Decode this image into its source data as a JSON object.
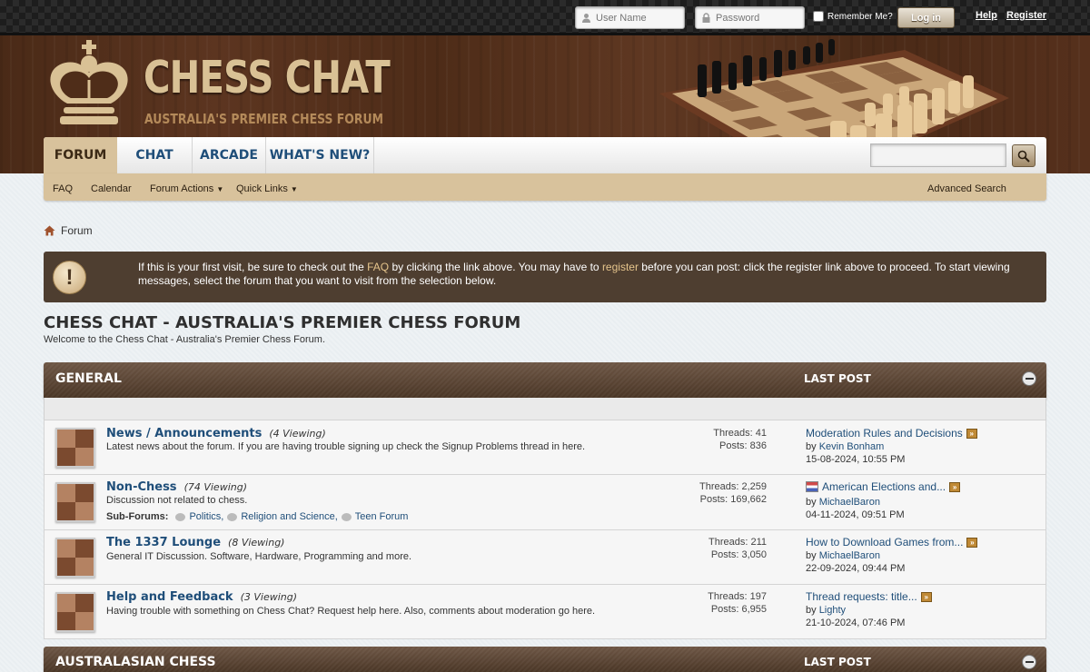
{
  "login": {
    "username_placeholder": "User Name",
    "password_placeholder": "Password",
    "remember_label": "Remember Me?",
    "login_button": "Log in",
    "help_link": "Help",
    "register_link": "Register"
  },
  "brand": {
    "title": "CHESS CHAT",
    "subtitle": "AUSTRALIA'S PREMIER CHESS FORUM"
  },
  "nav": {
    "tabs": [
      {
        "label": "FORUM",
        "active": true
      },
      {
        "label": "CHAT"
      },
      {
        "label": "ARCADE"
      },
      {
        "label": "WHAT'S NEW?"
      }
    ],
    "subnav": {
      "faq": "FAQ",
      "calendar": "Calendar",
      "forum_actions": "Forum Actions",
      "quick_links": "Quick Links",
      "advanced_search": "Advanced Search"
    }
  },
  "breadcrumb": {
    "label": "Forum"
  },
  "notice": {
    "icon": "!",
    "part1": "If this is your first visit, be sure to check out the ",
    "faq_link": "FAQ",
    "part2": " by clicking the link above. You may have to ",
    "register_link": "register",
    "part3": " before you can post: click the register link above to proceed. To start viewing messages, select the forum that you want to visit from the selection below."
  },
  "page": {
    "title": "CHESS CHAT - AUSTRALIA'S PREMIER CHESS FORUM",
    "welcome": "Welcome to the Chess Chat - Australia's Premier Chess Forum."
  },
  "categories": [
    {
      "title": "GENERAL",
      "last_post_header": "LAST POST"
    },
    {
      "title": "AUSTRALASIAN CHESS",
      "last_post_header": "LAST POST"
    }
  ],
  "forums": [
    {
      "name": "News / Announcements",
      "viewing": "(4 Viewing)",
      "description": "Latest news about the forum. If you are having trouble signing up check the Signup Problems thread in here.",
      "threads": "Threads: 41",
      "posts": "Posts: 836",
      "last_title": "Moderation Rules and Decisions",
      "last_by": "by",
      "last_user": "Kevin Bonham",
      "last_date": "15-08-2024,",
      "last_time": "10:55 PM"
    },
    {
      "name": "Non-Chess",
      "viewing": "(74 Viewing)",
      "description": "Discussion not related to chess.",
      "subforums_label": "Sub-Forums:",
      "subforums": [
        "Politics,",
        "Religion and Science,",
        "Teen Forum"
      ],
      "threads": "Threads: 2,259",
      "posts": "Posts: 169,662",
      "last_title": "American Elections and...",
      "last_by": "by",
      "last_user": "MichaelBaron",
      "last_date": "04-11-2024,",
      "last_time": "09:51 PM"
    },
    {
      "name": "The 1337 Lounge",
      "viewing": "(8 Viewing)",
      "description": "General IT Discussion. Software, Hardware, Programming and more.",
      "threads": "Threads: 211",
      "posts": "Posts: 3,050",
      "last_title": "How to Download Games from...",
      "last_by": "by",
      "last_user": "MichaelBaron",
      "last_date": "22-09-2024,",
      "last_time": "09:44 PM"
    },
    {
      "name": "Help and Feedback",
      "viewing": "(3 Viewing)",
      "description": "Having trouble with something on Chess Chat? Request help here. Also, comments about moderation go here.",
      "threads": "Threads: 197",
      "posts": "Posts: 6,955",
      "last_title": "Thread requests: title...",
      "last_by": "by",
      "last_user": "Lighty",
      "last_date": "21-10-2024,",
      "last_time": "07:46 PM"
    }
  ],
  "icons": {
    "user": "user-icon",
    "lock": "lock-icon",
    "search": "search-icon",
    "home": "home-icon",
    "crown": "crown-logo-icon",
    "collapse": "collapse-icon",
    "goto": "goto-last-post-icon"
  },
  "colors": {
    "brand_gold": "#d9c195",
    "link_blue": "#1f4e79",
    "notice_bg": "#4e3e30",
    "category_bg": "#4a3626"
  }
}
